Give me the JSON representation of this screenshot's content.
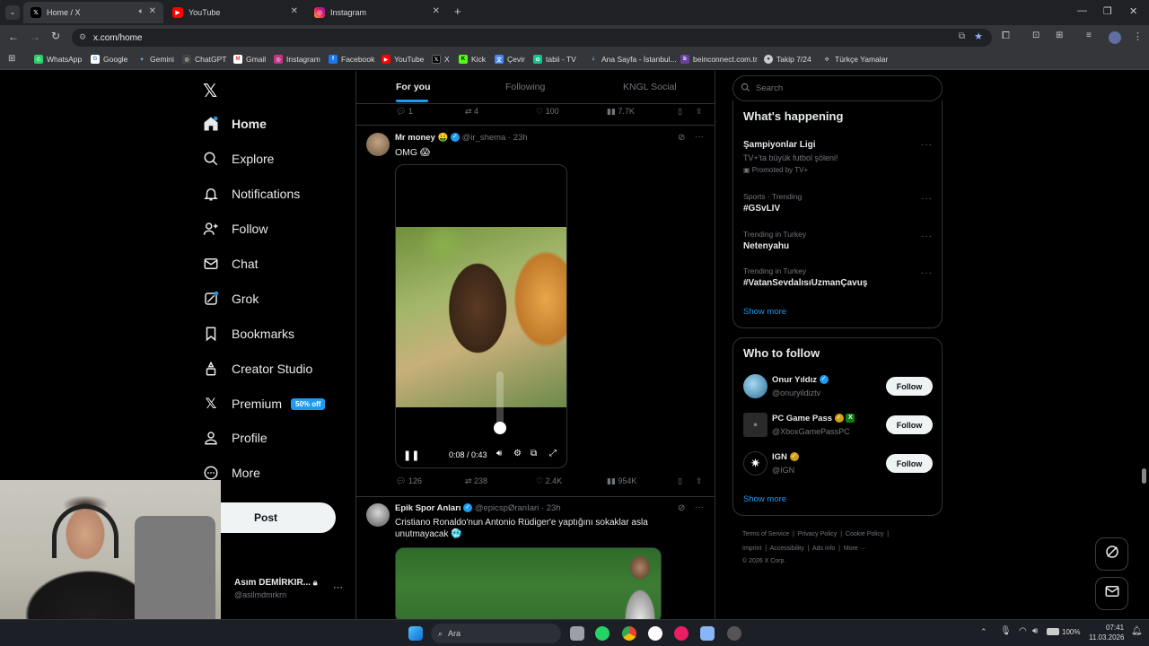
{
  "browser": {
    "tabs": [
      {
        "title": "Home / X",
        "icon": "x-logo-icon"
      },
      {
        "title": "YouTube",
        "icon": "youtube-icon"
      },
      {
        "title": "Instagram",
        "icon": "instagram-icon"
      }
    ],
    "url": "x.com/home",
    "bookmarks": [
      "WhatsApp",
      "Google",
      "Gemini",
      "ChatGPT",
      "Gmail",
      "Instagram",
      "Facebook",
      "YouTube",
      "X",
      "Kick",
      "Çevir",
      "tabii - TV",
      "Ana Sayfa - İstanbul...",
      "beinconnect.com.tr",
      "Takip 7/24",
      "Türkçe Yamalar"
    ]
  },
  "sidebar": {
    "items": [
      {
        "label": "Home",
        "icon": "home-icon"
      },
      {
        "label": "Explore",
        "icon": "search-icon"
      },
      {
        "label": "Notifications",
        "icon": "bell-icon"
      },
      {
        "label": "Follow",
        "icon": "add-user-icon"
      },
      {
        "label": "Chat",
        "icon": "mail-icon"
      },
      {
        "label": "Grok",
        "icon": "grok-icon"
      },
      {
        "label": "Bookmarks",
        "icon": "bookmark-icon"
      },
      {
        "label": "Creator Studio",
        "icon": "creator-icon"
      },
      {
        "label": "Premium",
        "icon": "x-logo-icon"
      },
      {
        "label": "Profile",
        "icon": "person-icon"
      },
      {
        "label": "More",
        "icon": "more-circle-icon"
      }
    ],
    "premium_badge": "50% off",
    "post_button": "Post",
    "account": {
      "name": "Asım DEMİRKIR...",
      "handle": "@asilmdmrkrn"
    }
  },
  "feed": {
    "tabs": [
      "For you",
      "Following",
      "KNGL Social"
    ],
    "prev_stats": {
      "replies": "1",
      "reposts": "4",
      "likes": "100",
      "views": "7.7K"
    },
    "post1": {
      "name": "Mr money 🤑",
      "handle": "@ir_shema",
      "time": "· 23h",
      "text": "OMG 😱",
      "video_time": "0:08 / 0:43",
      "stats": {
        "replies": "126",
        "reposts": "238",
        "likes": "2.4K",
        "views": "954K"
      }
    },
    "post2": {
      "name": "Epik Spor Anları",
      "handle": "@epicspØranIari",
      "time": "· 23h",
      "text": "Cristiano Ronaldo'nun Antonio Rüdiger'e yaptığını sokaklar asla unutmayacak 🥶"
    }
  },
  "right": {
    "search_placeholder": "Search",
    "happening_title": "What's happening",
    "trends": [
      {
        "meta": "",
        "name": "Şampiyonlar Ligi",
        "sub": "TV+'ta büyük futbol şöleni!",
        "promo": "Promoted by TV+"
      },
      {
        "meta": "Sports · Trending",
        "name": "#GSvLIV"
      },
      {
        "meta": "Trending in Turkey",
        "name": "Netenyahu"
      },
      {
        "meta": "Trending in Turkey",
        "name": "#VatanSevdalısıUzmanÇavuş"
      }
    ],
    "show_more": "Show more",
    "wtf_title": "Who to follow",
    "accounts": [
      {
        "name": "Onur Yıldız",
        "handle": "@onuryildiztv"
      },
      {
        "name": "PC Game Pass",
        "handle": "@XboxGamePassPC"
      },
      {
        "name": "IGN",
        "handle": "@IGN"
      }
    ],
    "follow_label": "Follow",
    "footer": {
      "line1": [
        "Terms of Service",
        "Privacy Policy",
        "Cookie Policy"
      ],
      "line2": [
        "Imprint",
        "Accessibility",
        "Ads info",
        "More ···"
      ],
      "copyright": "© 2026 X Corp."
    }
  },
  "taskbar": {
    "search": "Ara",
    "battery": "100%",
    "time": "07:41",
    "date": "11.03.2026"
  },
  "colors": {
    "accent": "#1d9bf0",
    "background": "#000000",
    "text": "#e7e9ea",
    "muted": "#71767b"
  }
}
